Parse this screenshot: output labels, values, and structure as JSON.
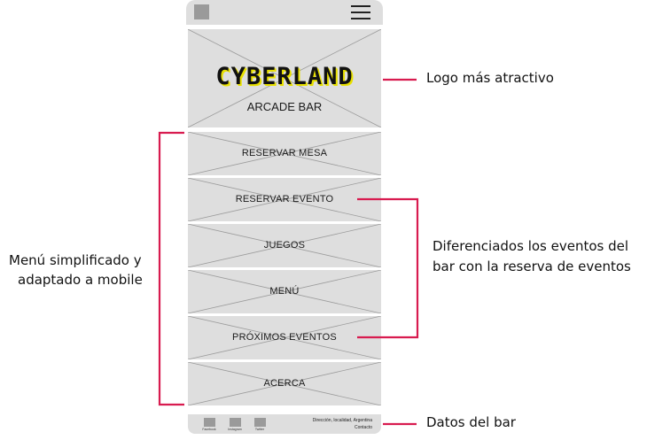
{
  "header": {
    "menu_icon": "hamburger-icon",
    "logo_icon": "logo-placeholder-icon"
  },
  "hero": {
    "logo_text": "CYBERLAND",
    "subtitle": "ARCADE BAR"
  },
  "menu": {
    "items": [
      {
        "label": "RESERVAR MESA"
      },
      {
        "label": "RESERVAR EVENTO"
      },
      {
        "label": "JUEGOS"
      },
      {
        "label": "MENÚ"
      },
      {
        "label": "PRÓXIMOS EVENTOS"
      },
      {
        "label": "ACERCA"
      }
    ]
  },
  "footer": {
    "social": [
      {
        "label": "Facebook",
        "icon": "facebook-icon"
      },
      {
        "label": "Instagram",
        "icon": "instagram-icon"
      },
      {
        "label": "Twitter",
        "icon": "twitter-icon"
      }
    ],
    "address": "Dirección, localidad, Argentina",
    "contact": "Contacto"
  },
  "annotations": {
    "logo": "Logo más atractivo",
    "menu_line1": "Menú simplificado y",
    "menu_line2": "adaptado a mobile",
    "events_line1": "Diferenciados los eventos del",
    "events_line2": "bar con la reserva de eventos",
    "footer": "Datos del bar"
  },
  "colors": {
    "annotation_line": "#d81b4f",
    "placeholder": "#dedede",
    "logo_accent": "#e8e000"
  }
}
